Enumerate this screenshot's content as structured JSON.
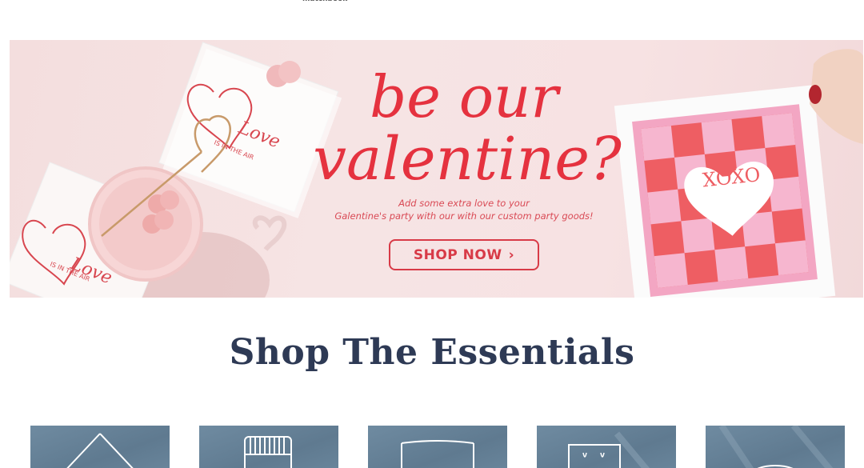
{
  "top_label": "matchbook",
  "hero": {
    "title_line1": "be our",
    "title_line2": "valentine?",
    "subtitle_line1": "Add some extra love to your",
    "subtitle_line2": "Galentine's party with our with our custom party goods!",
    "cta_label": "SHOP NOW",
    "napkin_text": "Love",
    "napkin_subtext": "IS IN THE AIR",
    "card_text": "XOXO"
  },
  "essentials": {
    "title": "Shop The Essentials",
    "tiles": [
      {
        "icon": "napkin-icon"
      },
      {
        "icon": "matchbook-icon"
      },
      {
        "icon": "cup-icon"
      },
      {
        "icon": "box-icon"
      },
      {
        "icon": "plate-icon"
      }
    ]
  },
  "colors": {
    "brand_red": "#e5323f",
    "navy": "#2e3a55",
    "tile_blue": "#6f8ba1"
  }
}
